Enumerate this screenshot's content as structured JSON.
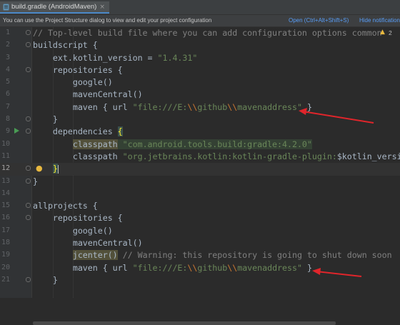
{
  "tab": {
    "title": "build.gradle (AndroidMaven)",
    "close": "×"
  },
  "notification": {
    "text": "You can use the Project Structure dialog to view and edit your project configuration",
    "open_link": "Open (Ctrl+Alt+Shift+S)",
    "hide_link": "Hide notification"
  },
  "inspection": {
    "warning_count": "2"
  },
  "colors": {
    "arrow": "#e0252b",
    "accent": "#4a88c7",
    "run": "#499c54"
  },
  "lines": {
    "n1": "1",
    "n2": "2",
    "n3": "3",
    "n4": "4",
    "n5": "5",
    "n6": "6",
    "n7": "7",
    "n8": "8",
    "n9": "9",
    "n10": "10",
    "n11": "11",
    "n12": "12",
    "n13": "13",
    "n14": "14",
    "n15": "15",
    "n16": "16",
    "n17": "17",
    "n18": "18",
    "n19": "19",
    "n20": "20",
    "n21": "21",
    "l1": "// Top-level build file where you can add configuration options common",
    "l2": "buildscript {",
    "l3a": "ext.kotlin_version = ",
    "l3b": "\"1.4.31\"",
    "l4": "repositories {",
    "l5": "google()",
    "l6": "mavenCentral()",
    "l7a": "maven { url ",
    "l7b": "\"file:///E:",
    "l7c": "\\\\",
    "l7d": "github",
    "l7e": "\\\\",
    "l7f": "mavenaddress\"",
    "l7g": " }",
    "l9a": "dependencies ",
    "l9b": "{",
    "l10a": "classpath",
    "l10b": " \"com.android.tools.build:gradle:4.2.0\"",
    "l11a": "classpath ",
    "l11b": "\"org.jetbrains.kotlin:kotlin-gradle-plugin:",
    "l11c": "$kotlin_versio",
    "l12": "}",
    "l13": "}",
    "l15": "allprojects {",
    "l16": "repositories {",
    "l17": "google()",
    "l18": "mavenCentral()",
    "l19a": "jcenter()",
    "l19b": " // Warning: this repository is going to shut down soon",
    "l20a": "maven { url ",
    "l20b": "\"file:///E:",
    "l20c": "\\\\",
    "l20d": "github",
    "l20e": "\\\\",
    "l20f": "mavenaddress\"",
    "l20g": " }",
    "l21": "}"
  }
}
